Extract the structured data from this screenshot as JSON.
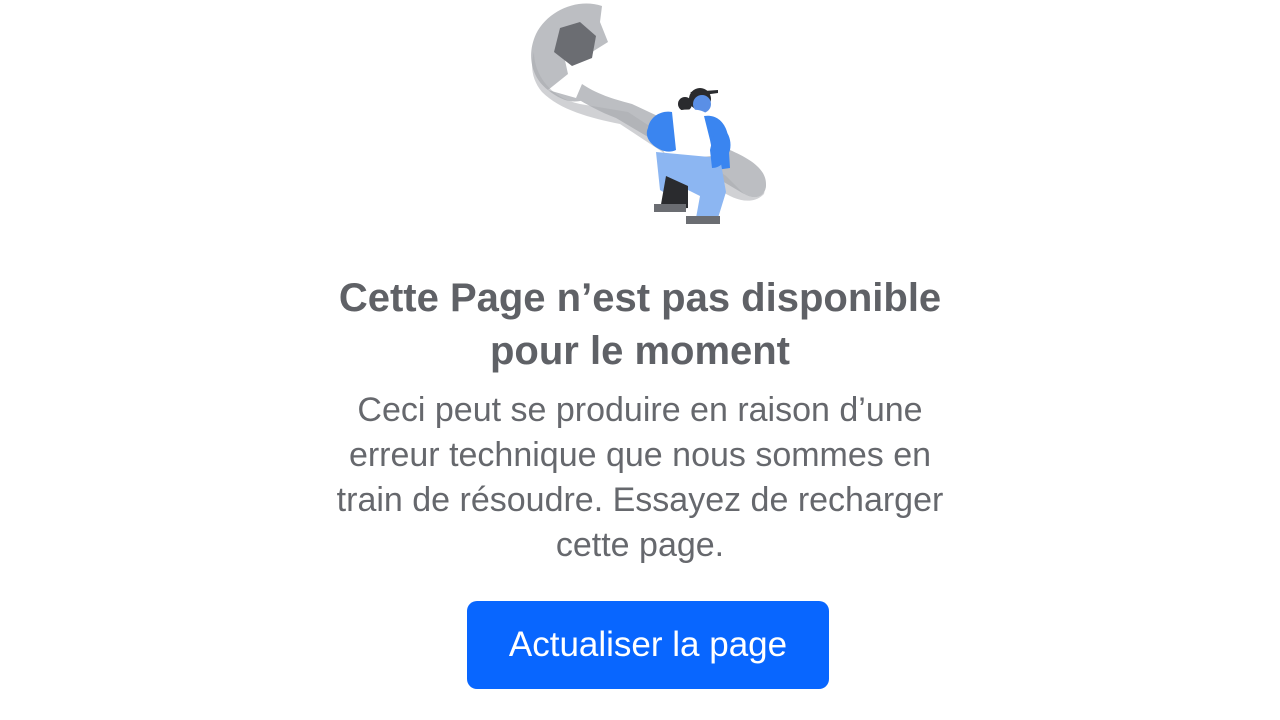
{
  "illustration": {
    "icon": "wrench-worker-illustration",
    "colors": {
      "wrench": "#bcbec2",
      "nut": "#6b6d72",
      "shirt": "#3a85f0",
      "pants": "#8cb6f2",
      "dark": "#2a2b2e"
    }
  },
  "error": {
    "title_line1": "Cette Page n’est pas disponible",
    "title_line2": "pour le moment",
    "desc_line1": "Ceci peut se produire en raison d’une",
    "desc_line2": "erreur technique que nous sommes en",
    "desc_line3": "train de résoudre. Essayez de recharger",
    "desc_line4": "cette page."
  },
  "actions": {
    "reload_label": "Actualiser la page"
  },
  "colors": {
    "accent": "#0866ff",
    "title": "#5f6166",
    "text": "#66686d",
    "background": "#ffffff"
  }
}
